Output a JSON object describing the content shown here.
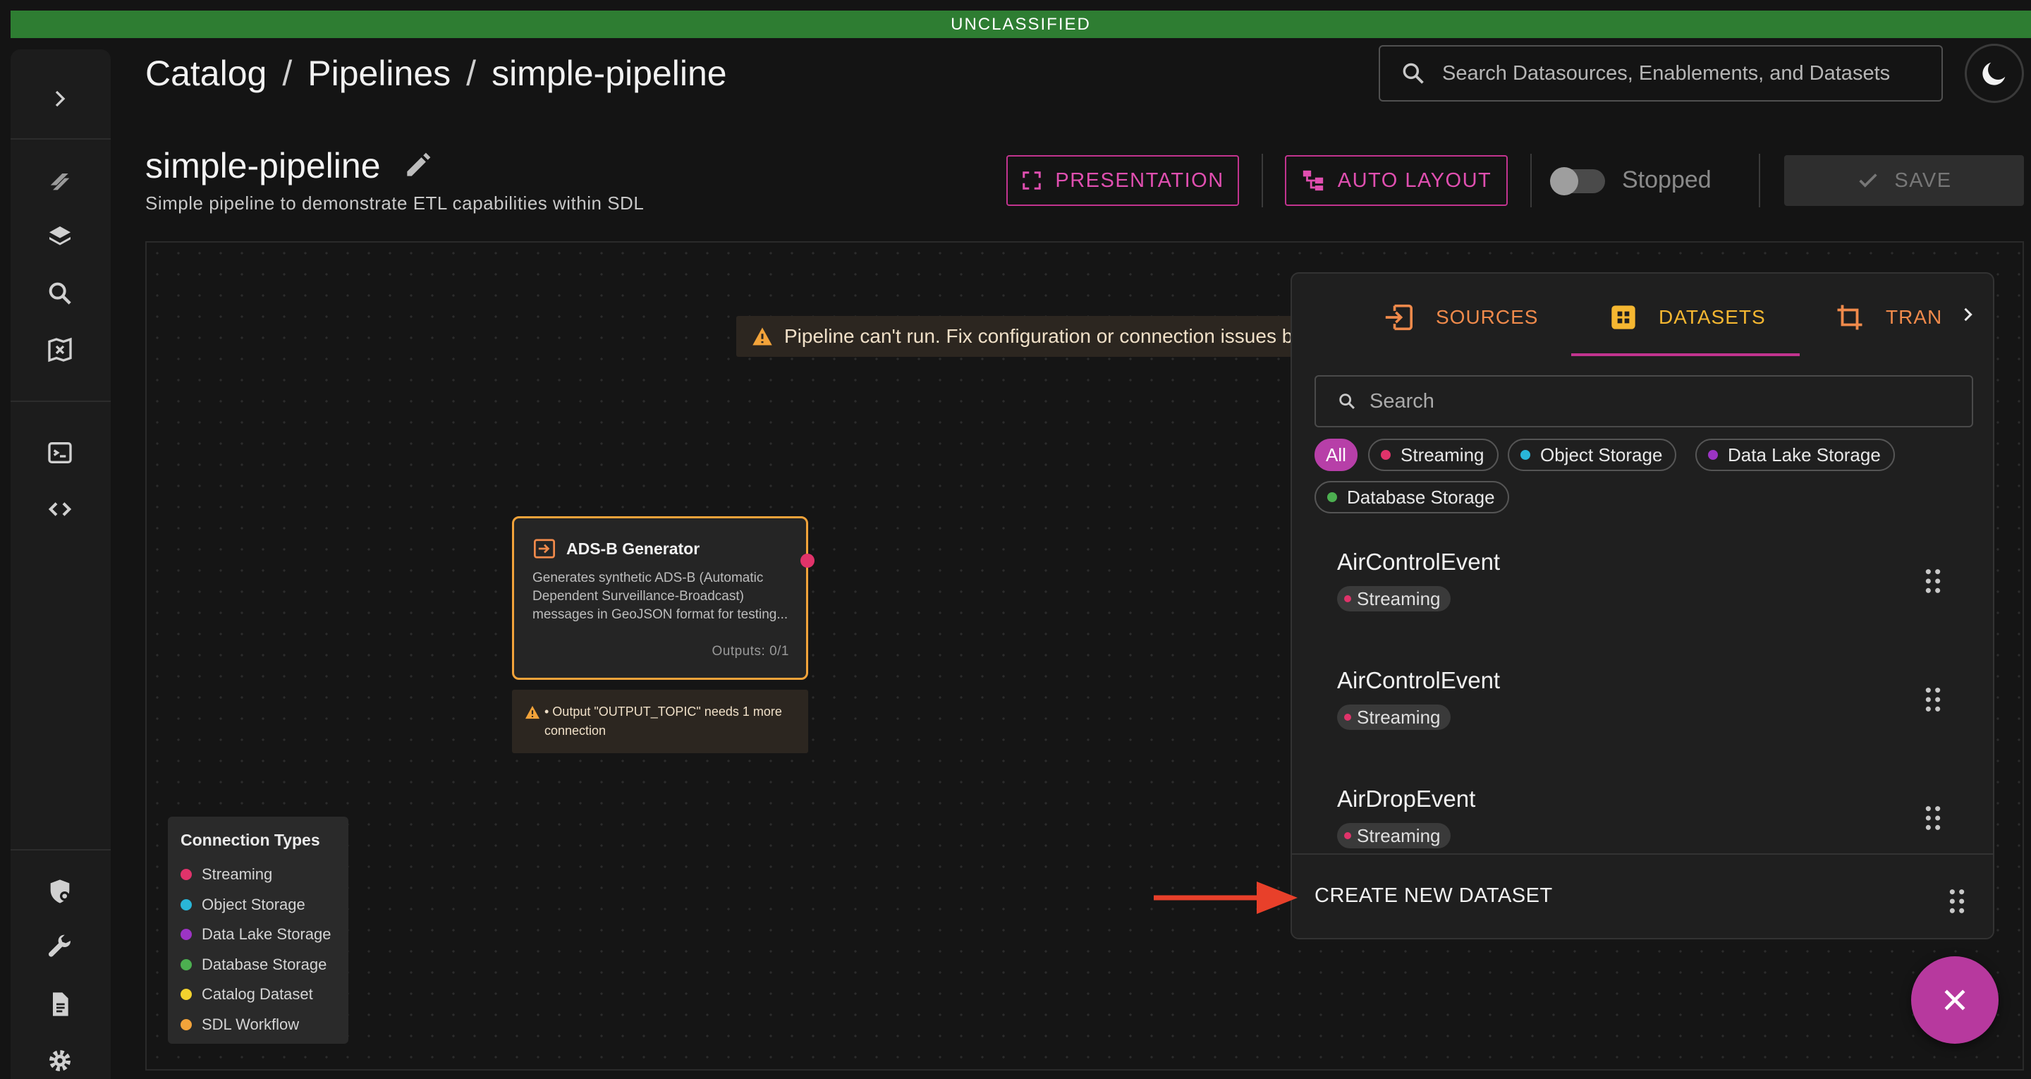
{
  "banner": "UNCLASSIFIED",
  "breadcrumb": [
    "Catalog",
    "Pipelines",
    "simple-pipeline"
  ],
  "search": {
    "placeholder": "Search Datasources, Enablements, and Datasets"
  },
  "pipeline": {
    "title": "simple-pipeline",
    "description": "Simple pipeline to demonstrate ETL capabilities within SDL"
  },
  "toolbar": {
    "presentation_label": "PRESENTATION",
    "auto_layout_label": "AUTO LAYOUT",
    "status_label": "Stopped",
    "save_label": "SAVE"
  },
  "canvas": {
    "warning": "Pipeline can't run. Fix configuration or connection issues b",
    "node": {
      "title": "ADS-B Generator",
      "description": "Generates synthetic ADS-B (Automatic Dependent Surveillance-Broadcast) messages in GeoJSON format for testing...",
      "outputs": "Outputs: 0/1",
      "warning": "• Output \"OUTPUT_TOPIC\" needs 1 more connection"
    },
    "legend": {
      "title": "Connection Types",
      "items": [
        {
          "label": "Streaming",
          "color": "#e0336a"
        },
        {
          "label": "Object Storage",
          "color": "#29b6d8"
        },
        {
          "label": "Data Lake Storage",
          "color": "#9c34c4"
        },
        {
          "label": "Database Storage",
          "color": "#4caf50"
        },
        {
          "label": "Catalog Dataset",
          "color": "#f2d22e"
        },
        {
          "label": "SDL Workflow",
          "color": "#f2a33a"
        }
      ]
    }
  },
  "panel": {
    "tabs": [
      {
        "label": "SOURCES",
        "color": "#f08a4b"
      },
      {
        "label": "DATASETS",
        "color": "#f5b731"
      },
      {
        "label": "TRAN",
        "color": "#f08a4b"
      }
    ],
    "search_placeholder": "Search",
    "filters": [
      {
        "label": "All"
      },
      {
        "label": "Streaming",
        "color": "#e0336a"
      },
      {
        "label": "Object Storage",
        "color": "#29b6d8"
      },
      {
        "label": "Data Lake Storage",
        "color": "#9c34c4"
      },
      {
        "label": "Database Storage",
        "color": "#4caf50"
      }
    ],
    "datasets": [
      {
        "name": "AirControlEvent",
        "type": "Streaming"
      },
      {
        "name": "AirControlEvent",
        "type": "Streaming"
      },
      {
        "name": "AirDropEvent",
        "type": "Streaming"
      }
    ],
    "create_label": "CREATE NEW DATASET"
  },
  "colors": {
    "accent": "#c2348f",
    "warning": "#f2a33a",
    "banner": "#2e7d32"
  }
}
